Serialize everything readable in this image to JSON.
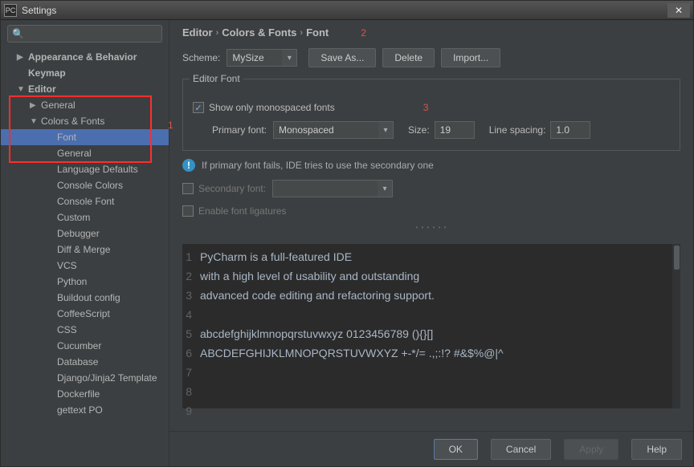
{
  "window": {
    "title": "Settings"
  },
  "sidebar": {
    "search_placeholder": "",
    "items": [
      {
        "label": "Appearance & Behavior",
        "level": 1,
        "arrow": "▶"
      },
      {
        "label": "Keymap",
        "level": 1,
        "arrow": ""
      },
      {
        "label": "Editor",
        "level": 1,
        "arrow": "▼"
      },
      {
        "label": "General",
        "level": 2,
        "arrow": "▶"
      },
      {
        "label": "Colors & Fonts",
        "level": 2,
        "arrow": "▼"
      },
      {
        "label": "Font",
        "level": 3,
        "selected": true
      },
      {
        "label": "General",
        "level": 3
      },
      {
        "label": "Language Defaults",
        "level": 3
      },
      {
        "label": "Console Colors",
        "level": 3
      },
      {
        "label": "Console Font",
        "level": 3
      },
      {
        "label": "Custom",
        "level": 3
      },
      {
        "label": "Debugger",
        "level": 3
      },
      {
        "label": "Diff & Merge",
        "level": 3
      },
      {
        "label": "VCS",
        "level": 3
      },
      {
        "label": "Python",
        "level": 3
      },
      {
        "label": "Buildout config",
        "level": 3
      },
      {
        "label": "CoffeeScript",
        "level": 3
      },
      {
        "label": "CSS",
        "level": 3
      },
      {
        "label": "Cucumber",
        "level": 3
      },
      {
        "label": "Database",
        "level": 3
      },
      {
        "label": "Django/Jinja2 Template",
        "level": 3
      },
      {
        "label": "Dockerfile",
        "level": 3
      },
      {
        "label": "gettext PO",
        "level": 3
      }
    ]
  },
  "breadcrumb": {
    "a": "Editor",
    "b": "Colors & Fonts",
    "c": "Font"
  },
  "annotations": {
    "a1": "1",
    "a2": "2",
    "a3": "3"
  },
  "scheme": {
    "label": "Scheme:",
    "value": "MySize"
  },
  "buttons": {
    "saveas": "Save As...",
    "delete": "Delete",
    "import": "Import..."
  },
  "editorFont": {
    "legend": "Editor Font",
    "showMono": "Show only monospaced fonts",
    "primary": "Primary font:",
    "primaryValue": "Monospaced",
    "size": "Size:",
    "sizeValue": "19",
    "spacing": "Line spacing:",
    "spacingValue": "1.0",
    "info": "If primary font fails, IDE tries to use the secondary one",
    "secondary": "Secondary font:",
    "secondaryValue": "",
    "ligatures": "Enable font ligatures"
  },
  "preview": {
    "lines": [
      "PyCharm is a full-featured IDE",
      "with a high level of usability and outstanding",
      "advanced code editing and refactoring support.",
      "",
      "abcdefghijklmnopqrstuvwxyz 0123456789 (){}[]",
      "ABCDEFGHIJKLMNOPQRSTUVWXYZ +-*/= .,;:!? #&$%@|^",
      "",
      "",
      ""
    ]
  },
  "footer": {
    "ok": "OK",
    "cancel": "Cancel",
    "apply": "Apply",
    "help": "Help"
  }
}
